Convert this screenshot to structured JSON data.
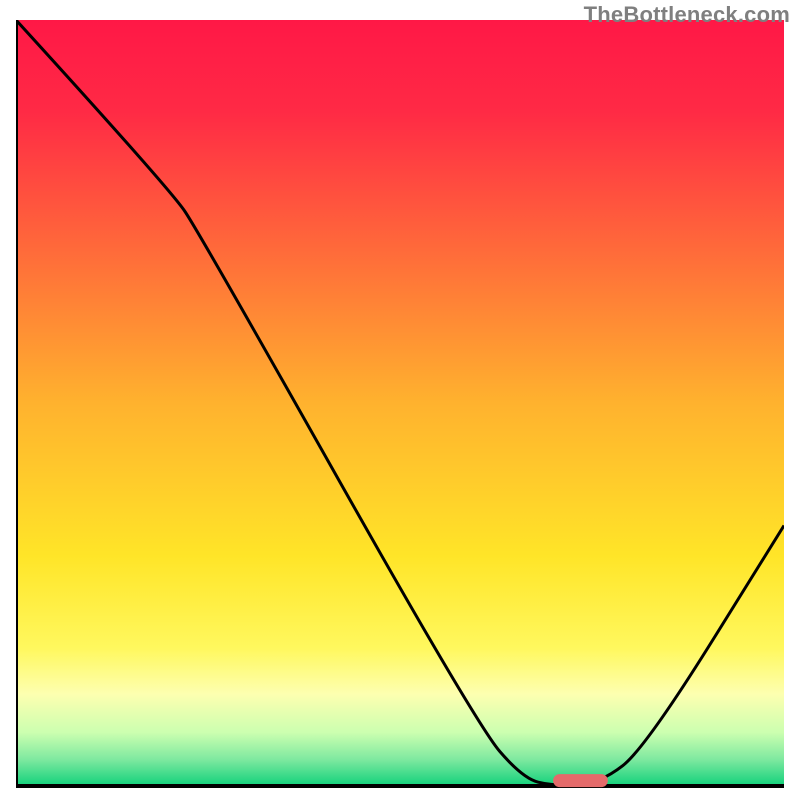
{
  "watermark": "TheBottleneck.com",
  "colors": {
    "gradient_stops": [
      {
        "offset": 0,
        "color": "#ff1846"
      },
      {
        "offset": 0.12,
        "color": "#ff2a45"
      },
      {
        "offset": 0.3,
        "color": "#ff6a3a"
      },
      {
        "offset": 0.5,
        "color": "#ffb22e"
      },
      {
        "offset": 0.7,
        "color": "#ffe528"
      },
      {
        "offset": 0.82,
        "color": "#fff85e"
      },
      {
        "offset": 0.88,
        "color": "#fdffb0"
      },
      {
        "offset": 0.93,
        "color": "#ccffb0"
      },
      {
        "offset": 0.965,
        "color": "#7fe9a0"
      },
      {
        "offset": 1.0,
        "color": "#11d17b"
      }
    ],
    "axis": "#000000",
    "curve": "#000000",
    "marker_fill": "#e46a6a",
    "marker_stroke": "#e46a6a"
  },
  "chart_data": {
    "type": "line",
    "title": "",
    "xlabel": "",
    "ylabel": "",
    "xlim": [
      0,
      100
    ],
    "ylim": [
      0,
      100
    ],
    "legend": false,
    "grid": false,
    "curve": [
      {
        "x": 0,
        "y": 100
      },
      {
        "x": 20,
        "y": 78
      },
      {
        "x": 24,
        "y": 72
      },
      {
        "x": 60,
        "y": 8
      },
      {
        "x": 66,
        "y": 1
      },
      {
        "x": 70,
        "y": 0
      },
      {
        "x": 76,
        "y": 0.3
      },
      {
        "x": 82,
        "y": 5
      },
      {
        "x": 100,
        "y": 34
      }
    ],
    "optimum_marker": {
      "x_start": 70,
      "x_end": 77,
      "y": 0.7
    }
  }
}
